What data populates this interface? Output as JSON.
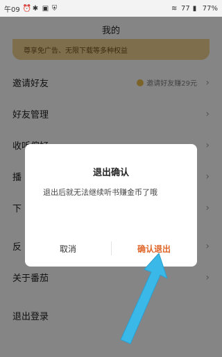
{
  "status_bar": {
    "time": "午09",
    "network": "77",
    "battery": "77%"
  },
  "header": {
    "title": "我的"
  },
  "banner": {
    "text": "尊享免广告、无限下载等多种权益"
  },
  "menu": {
    "items": [
      {
        "label": "邀请好友",
        "extra": "邀请好友赚29元"
      },
      {
        "label": "好友管理"
      },
      {
        "label": "收听偏好"
      },
      {
        "label": "播"
      },
      {
        "label": "下"
      },
      {
        "label": "反"
      },
      {
        "label": "关于番茄"
      },
      {
        "label": "退出登录"
      }
    ]
  },
  "dialog": {
    "title": "退出确认",
    "message": "退出后就无法继续听书赚金币了哦",
    "cancel_label": "取消",
    "confirm_label": "确认退出"
  },
  "colors": {
    "accent": "#e0662a",
    "arrow": "#3ab8e8",
    "banner": "#e7c989"
  }
}
